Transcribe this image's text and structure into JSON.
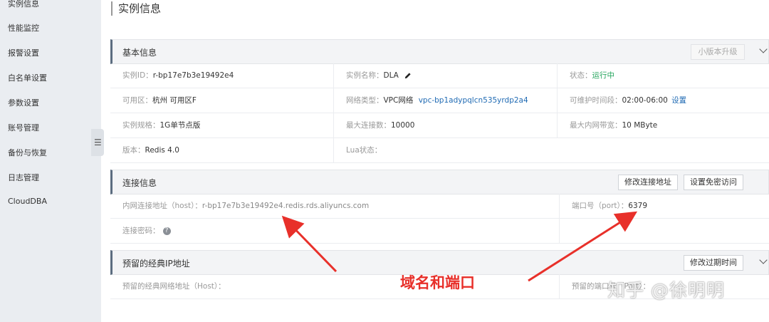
{
  "sidebar": {
    "items": [
      {
        "label": "实例信息"
      },
      {
        "label": "性能监控"
      },
      {
        "label": "报警设置"
      },
      {
        "label": "白名单设置"
      },
      {
        "label": "参数设置"
      },
      {
        "label": "账号管理"
      },
      {
        "label": "备份与恢复"
      },
      {
        "label": "日志管理"
      },
      {
        "label": "CloudDBA"
      }
    ]
  },
  "page": {
    "title": "实例信息"
  },
  "basic": {
    "title": "基本信息",
    "upgrade_button": "小版本升级",
    "instance_id_label": "实例ID：",
    "instance_id": "r-bp17e7b3e19492e4",
    "instance_name_label": "实例名称：",
    "instance_name": "DLA",
    "status_label": "状态：",
    "status": "运行中",
    "zone_label": "可用区：",
    "zone": "杭州 可用区F",
    "network_label": "网络类型：",
    "network": "VPC网络",
    "vpc": "vpc-bp1adypqlcn535yrdp2a4",
    "maint_label": "可维护时间段：",
    "maint": "02:00-06:00",
    "maint_link": "设置",
    "spec_label": "实例规格：",
    "spec": "1G单节点版",
    "maxconn_label": "最大连接数：",
    "maxconn": "10000",
    "bandwidth_label": "最大内网带宽：",
    "bandwidth": "10 MByte",
    "version_label": "版本：",
    "version": "Redis 4.0",
    "lua_label": "Lua状态："
  },
  "connection": {
    "title": "连接信息",
    "modify_button": "修改连接地址",
    "nopass_button": "设置免密访问",
    "host_label": "内网连接地址（host）：",
    "host": "r-bp17e7b3e19492e4.redis.rds.aliyuncs.com",
    "port_label": "端口号（port）：",
    "port": "6379",
    "password_label": "连接密码："
  },
  "reserved": {
    "title": "预留的经典IP地址",
    "expire_button": "修改过期时间",
    "host_label": "预留的经典网络地址（Host）：",
    "port_label": "预留的端口号（Port）："
  },
  "annotation": {
    "text": "域名和端口",
    "color": "#e8302a"
  },
  "watermark": {
    "text": "知乎 @徐明明"
  },
  "colors": {
    "status_ok": "#21a35a",
    "link": "#1f6ab3",
    "section_accent": "#5c6d80"
  }
}
